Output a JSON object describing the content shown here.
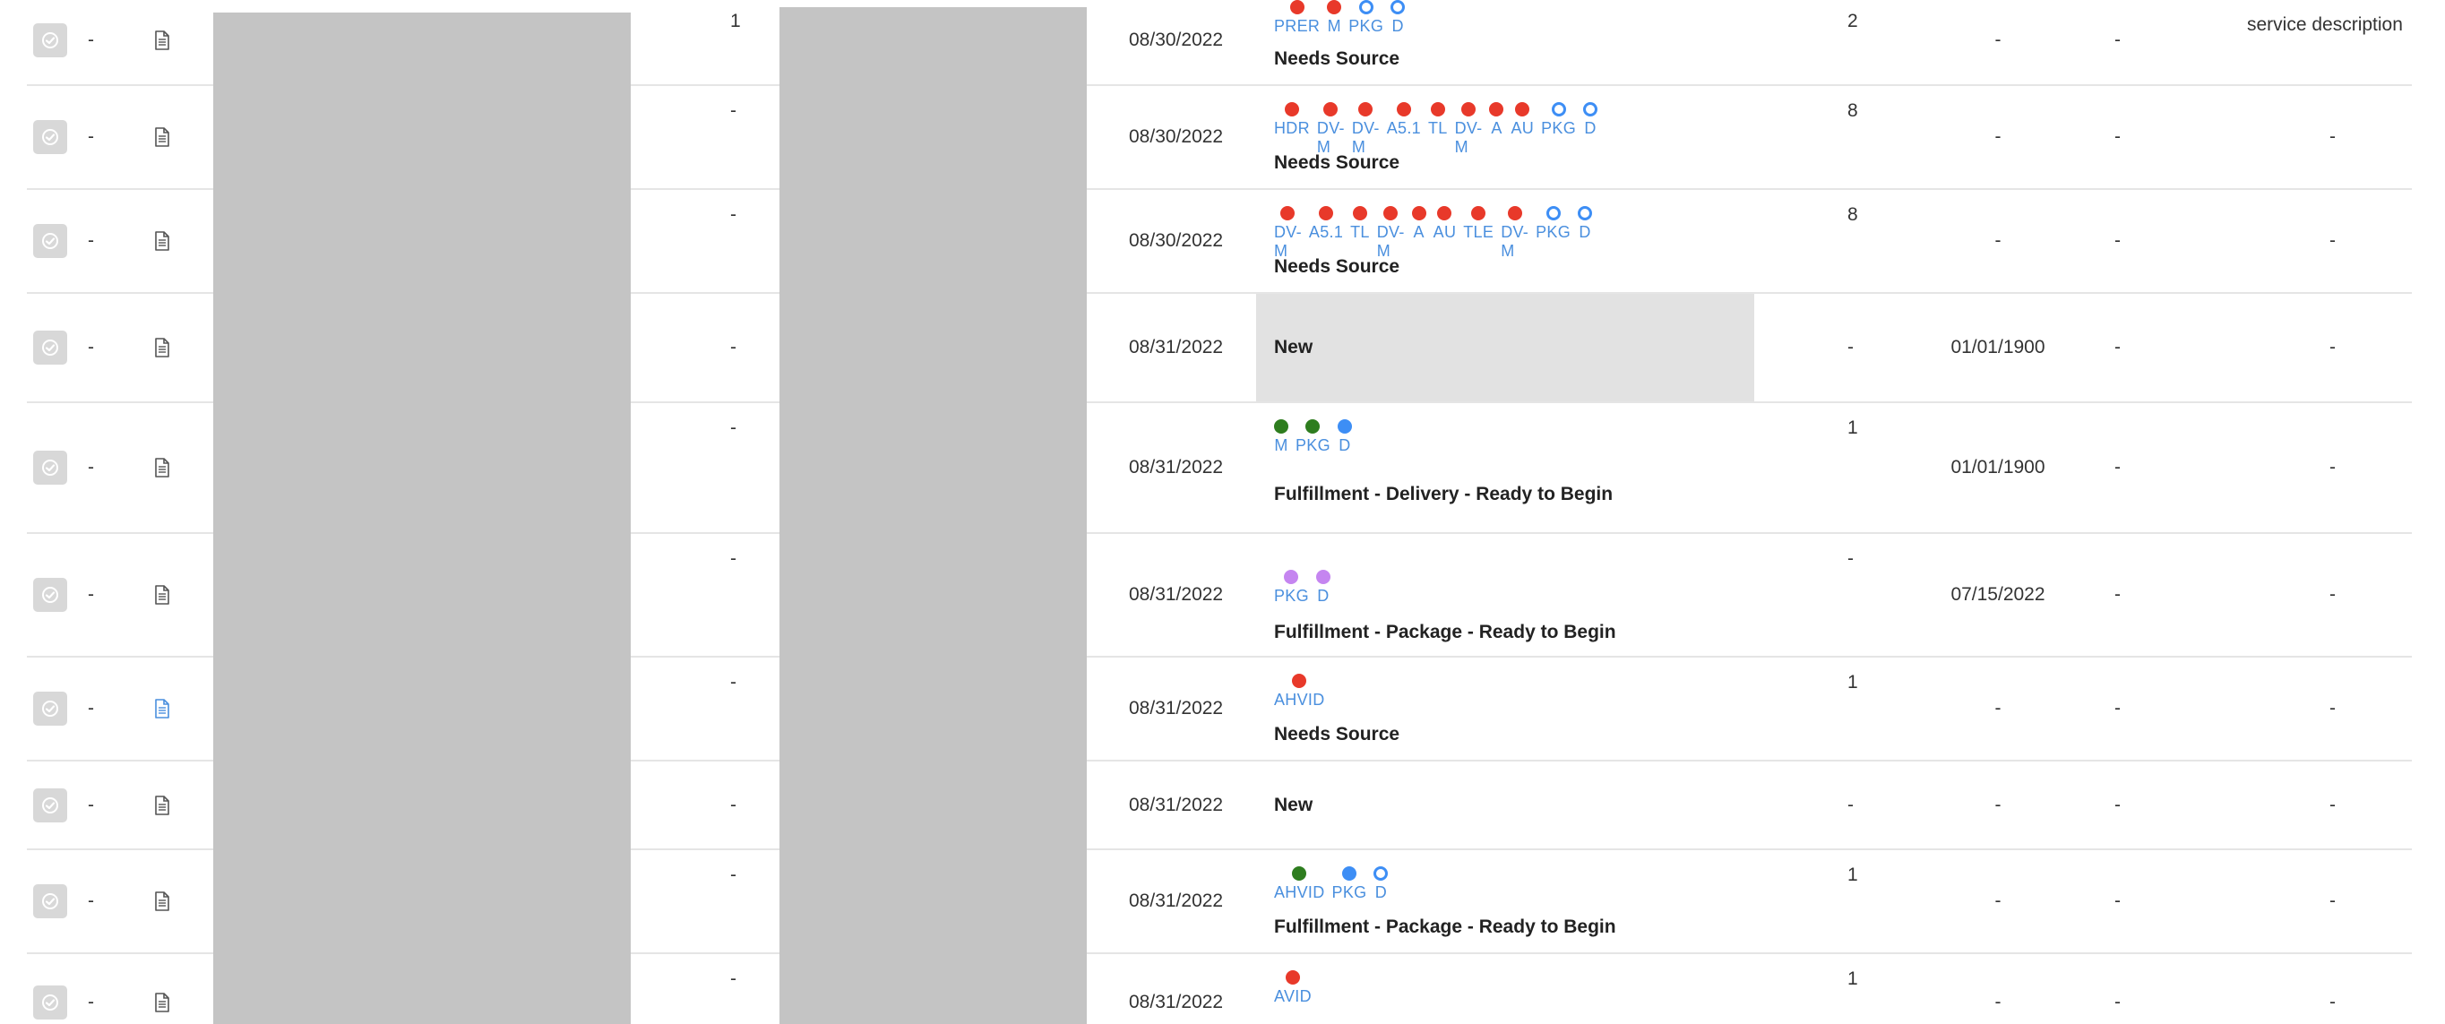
{
  "colors": {
    "red": "#e8392a",
    "green": "#2e7d1f",
    "blue": "#3d8ef5",
    "purple": "#c585f0",
    "chip_text": "#4a8fde",
    "placeholder_gray": "#c4c4c4"
  },
  "icons": {
    "checkbox": "check-circle-icon",
    "document": "document-icon"
  },
  "rows": [
    {
      "a": "-",
      "num": "1",
      "date": "08/30/2022",
      "count": "2",
      "due": "-",
      "c3": "-",
      "service": "service description",
      "chips": [
        {
          "l": "PRER",
          "c": "red",
          "f": true
        },
        {
          "l": "M",
          "c": "red",
          "f": true
        },
        {
          "l": "PKG",
          "c": "blue",
          "f": false
        },
        {
          "l": "D",
          "c": "blue",
          "f": false
        }
      ],
      "status": "Needs Source"
    },
    {
      "a": "-",
      "num": "-",
      "date": "08/30/2022",
      "count": "8",
      "due": "-",
      "c3": "-",
      "service": "-",
      "chips": [
        {
          "l": "HDR",
          "c": "red",
          "f": true
        },
        {
          "l": "DV-M",
          "c": "red",
          "f": true
        },
        {
          "l": "DV-M",
          "c": "red",
          "f": true
        },
        {
          "l": "A5.1",
          "c": "red",
          "f": true
        },
        {
          "l": "TL",
          "c": "red",
          "f": true
        },
        {
          "l": "DV-M",
          "c": "red",
          "f": true
        },
        {
          "l": "A",
          "c": "red",
          "f": true
        },
        {
          "l": "AU",
          "c": "red",
          "f": true
        },
        {
          "l": "PKG",
          "c": "blue",
          "f": false
        },
        {
          "l": "D",
          "c": "blue",
          "f": false
        }
      ],
      "status": "Needs Source"
    },
    {
      "a": "-",
      "num": "-",
      "date": "08/30/2022",
      "count": "8",
      "due": "-",
      "c3": "-",
      "service": "-",
      "chips": [
        {
          "l": "DV-M",
          "c": "red",
          "f": true
        },
        {
          "l": "A5.1",
          "c": "red",
          "f": true
        },
        {
          "l": "TL",
          "c": "red",
          "f": true
        },
        {
          "l": "DV-M",
          "c": "red",
          "f": true
        },
        {
          "l": "A",
          "c": "red",
          "f": true
        },
        {
          "l": "AU",
          "c": "red",
          "f": true
        },
        {
          "l": "TLE",
          "c": "red",
          "f": true
        },
        {
          "l": "DV-M",
          "c": "red",
          "f": true
        },
        {
          "l": "PKG",
          "c": "blue",
          "f": false
        },
        {
          "l": "D",
          "c": "blue",
          "f": false
        }
      ],
      "status": "Needs Source"
    },
    {
      "a": "-",
      "num": "-",
      "date": "08/31/2022",
      "count": "-",
      "due": "01/01/1900",
      "c3": "-",
      "service": "-",
      "chips": [],
      "status": "New"
    },
    {
      "a": "-",
      "num": "-",
      "date": "08/31/2022",
      "count": "1",
      "due": "01/01/1900",
      "c3": "-",
      "service": "-",
      "chips": [
        {
          "l": "M",
          "c": "green",
          "f": true
        },
        {
          "l": "PKG",
          "c": "green",
          "f": true
        },
        {
          "l": "D",
          "c": "blue",
          "f": true
        }
      ],
      "status": "Fulfillment - Delivery - Ready to Begin"
    },
    {
      "a": "-",
      "num": "-",
      "date": "08/31/2022",
      "count": "-",
      "due": "07/15/2022",
      "c3": "-",
      "service": "-",
      "chips": [
        {
          "l": "PKG",
          "c": "purple",
          "f": true
        },
        {
          "l": "D",
          "c": "purple",
          "f": true
        }
      ],
      "status": "Fulfillment - Package - Ready to Begin"
    },
    {
      "a": "-",
      "num": "-",
      "date": "08/31/2022",
      "count": "1",
      "due": "-",
      "c3": "-",
      "service": "-",
      "chips": [
        {
          "l": "AHVID",
          "c": "red",
          "f": true
        }
      ],
      "status": "Needs Source",
      "doc_active": true
    },
    {
      "a": "-",
      "num": "-",
      "date": "08/31/2022",
      "count": "-",
      "due": "-",
      "c3": "-",
      "service": "-",
      "chips": [],
      "status": "New"
    },
    {
      "a": "-",
      "num": "-",
      "date": "08/31/2022",
      "count": "1",
      "due": "-",
      "c3": "-",
      "service": "-",
      "chips": [
        {
          "l": "AHVID",
          "c": "green",
          "f": true
        },
        {
          "l": "PKG",
          "c": "blue",
          "f": true
        },
        {
          "l": "D",
          "c": "blue",
          "f": false
        }
      ],
      "status": "Fulfillment - Package - Ready to Begin"
    },
    {
      "a": "-",
      "num": "-",
      "date": "08/31/2022",
      "count": "1",
      "due": "-",
      "c3": "-",
      "service": "-",
      "chips": [
        {
          "l": "AVID",
          "c": "red",
          "f": true
        }
      ],
      "status": ""
    }
  ]
}
